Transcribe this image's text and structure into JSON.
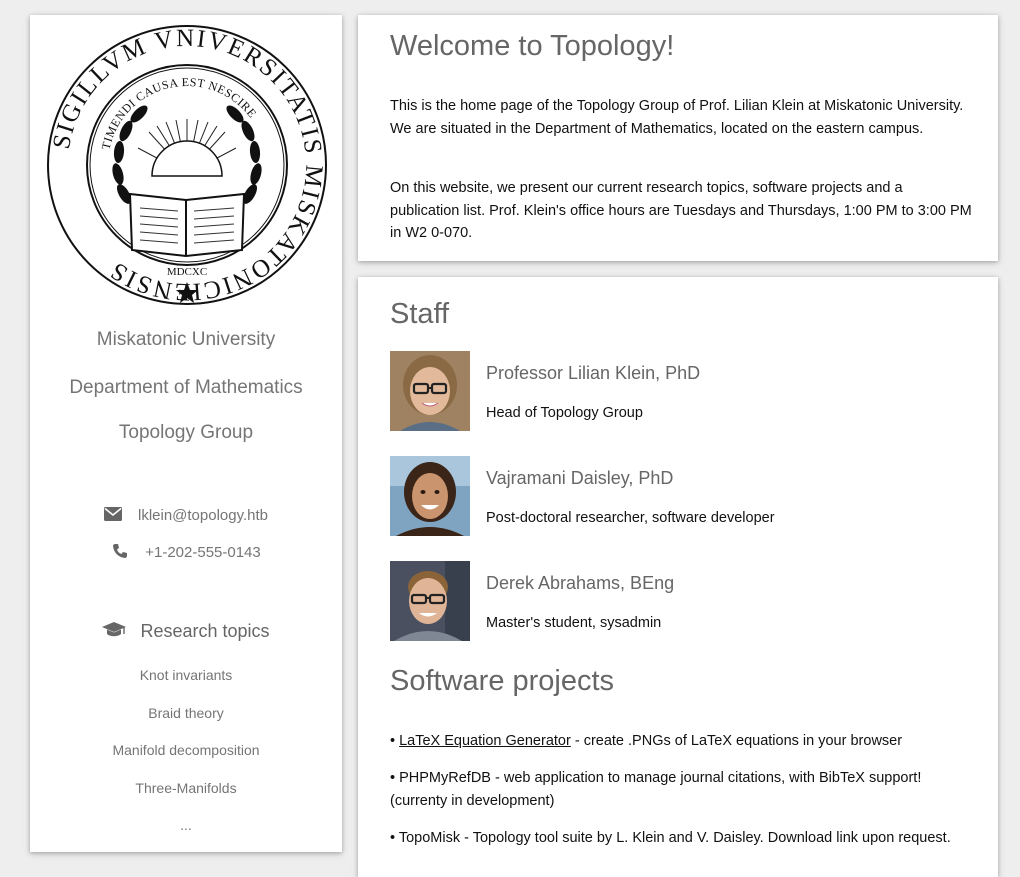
{
  "sidebar": {
    "seal": {
      "outer_text": "SIGILLVM VNIVERSITATIS MISKATONICIENSIS",
      "inner_text": "TIMENDI CAUSA EST NESCIRE",
      "year": "MDCXC"
    },
    "university": "Miskatonic University",
    "department": "Department of Mathematics",
    "group": "Topology Group",
    "email": "lklein@topology.htb",
    "phone": "+1-202-555-0143",
    "research_heading": "Research topics",
    "research_topics": [
      "Knot invariants",
      "Braid theory",
      "Manifold decomposition",
      "Three-Manifolds",
      "..."
    ]
  },
  "welcome": {
    "title": "Welcome to Topology!",
    "paragraph1": "This is the home page of the Topology Group of Prof. Lilian Klein at Miskatonic University. We are situated in the Department of Mathematics, located on the eastern campus.",
    "paragraph2": "On this website, we present our current research topics, software projects and a publication list. Prof. Klein's office hours are Tuesdays and Thursdays, 1:00 PM to 3:00 PM in W2 0-070."
  },
  "staff": {
    "title": "Staff",
    "members": [
      {
        "name": "Professor Lilian Klein, PhD",
        "role": "Head of Topology Group"
      },
      {
        "name": "Vajramani Daisley, PhD",
        "role": "Post-doctoral researcher, software developer"
      },
      {
        "name": "Derek Abrahams, BEng",
        "role": "Master's student, sysadmin"
      }
    ]
  },
  "software": {
    "title": "Software projects",
    "items": [
      {
        "bullet": "•",
        "link": "LaTeX Equation Generator",
        "text": " - create .PNGs of LaTeX equations in your browser"
      },
      {
        "bullet": "•",
        "link": "",
        "text": "PHPMyRefDB - web application to manage journal citations, with BibTeX support! (currenty in development)"
      },
      {
        "bullet": "•",
        "link": "",
        "text": "TopoMisk - Topology tool suite by L. Klein and V. Daisley. Download link upon request."
      }
    ]
  }
}
